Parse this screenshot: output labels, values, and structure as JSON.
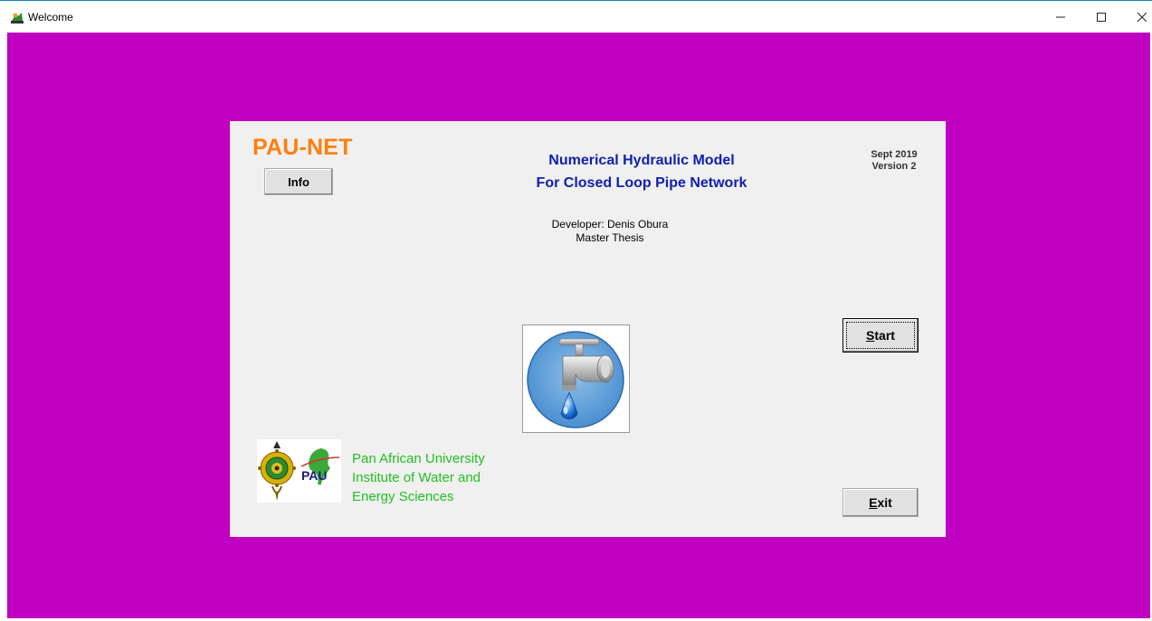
{
  "window": {
    "title": "Welcome",
    "controls": {
      "minimize": "—",
      "maximize": "☐",
      "close": "✕"
    }
  },
  "colors": {
    "background": "#c000c0",
    "panel": "#f0f0f0",
    "app_name": "#ff7f0e",
    "heading": "#1020b0",
    "university": "#22c022"
  },
  "welcome": {
    "app_name": "PAU-NET",
    "info_button": "Info",
    "heading_line1": "Numerical Hydraulic Model",
    "heading_line2": "For Closed Loop Pipe Network",
    "date": "Sept 2019",
    "version": "Version 2",
    "developer": "Developer: Denis Obura",
    "thesis": "Master Thesis",
    "start_button": "Start",
    "exit_button": "Exit",
    "tap_image_icon": "water-tap-icon",
    "logos": {
      "seal_icon": "university-seal-icon",
      "pau_logo_text": "PAU"
    },
    "university": {
      "line1": "Pan African University",
      "line2": "Institute of Water and",
      "line3": "Energy Sciences"
    }
  }
}
